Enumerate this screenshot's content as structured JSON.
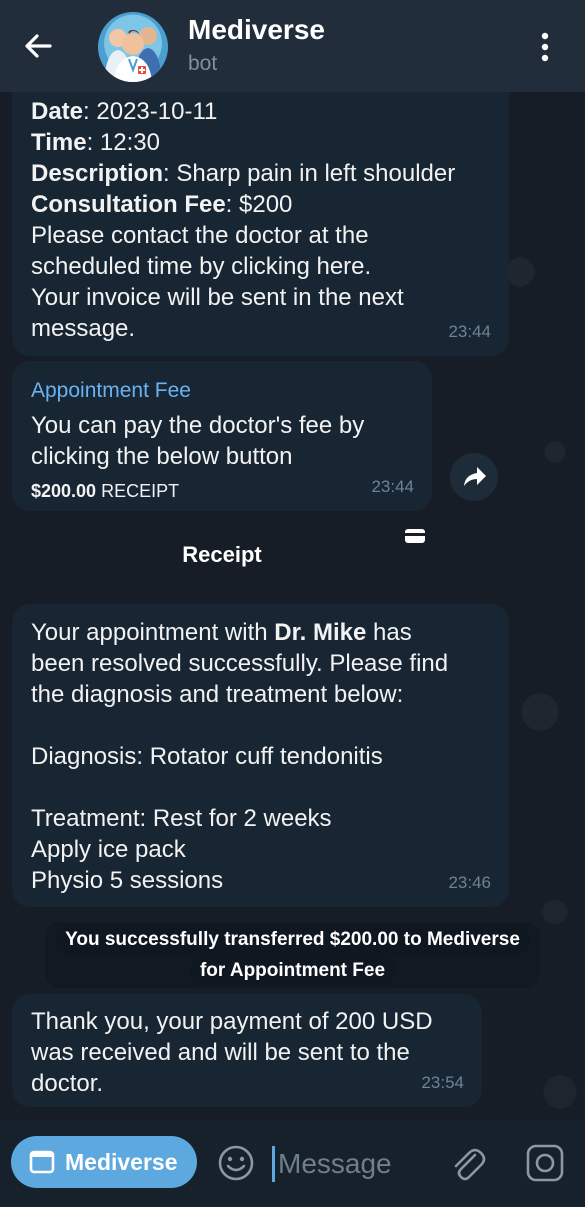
{
  "header": {
    "title": "Mediverse",
    "subtitle": "bot",
    "back_icon": "arrow-left-icon",
    "menu_icon": "more-vertical-icon"
  },
  "messages": {
    "first": {
      "date_label": "Date",
      "date_value": ": 2023-10-11",
      "time_label": "Time",
      "time_value": ": 12:30",
      "description_label": "Description",
      "description_value": ": Sharp pain in left shoulder",
      "fee_label": "Consultation Fee",
      "fee_value": ": $200",
      "lines": [
        "Please contact the doctor at the",
        "scheduled time by clicking here.",
        "Your invoice will be sent in the next",
        "message."
      ],
      "time": "23:44"
    },
    "invoice": {
      "title": "Appointment Fee",
      "lines": [
        "You can pay the doctor's fee by",
        "clicking the below button"
      ],
      "amount": "$200.00",
      "amount_suffix": " RECEIPT",
      "time": "23:44",
      "forward_icon": "share-forward-icon"
    },
    "receipt_button": {
      "label": "Receipt",
      "icon": "credit-card-icon"
    },
    "resolution": {
      "intro_before": "Your appointment with ",
      "doctor": "Dr. Mike",
      "intro_after": " has",
      "lines": [
        "been resolved successfully. Please find",
        "the diagnosis and treatment below:"
      ],
      "diagnosis": "Diagnosis: Rotator cuff tendonitis",
      "treatment_lines": [
        "Treatment: Rest for 2 weeks",
        "Apply ice pack",
        "Physio 5 sessions"
      ],
      "time": "23:46"
    },
    "service": {
      "line1": "You successfully transferred $200.00 to Mediverse",
      "line2": "for Appointment Fee"
    },
    "payment": {
      "lines": [
        "Thank you, your payment of 200 USD",
        "was received and will be sent to the",
        "doctor."
      ],
      "time": "23:54"
    }
  },
  "input_bar": {
    "menu_label": "Mediverse",
    "placeholder": "Message",
    "emoji_icon": "emoji-icon",
    "attach_icon": "paperclip-icon",
    "camera_icon": "camera-icon"
  },
  "colors": {
    "header_bg": "#212d3b",
    "bubble_bg": "#182533",
    "accent": "#5ea8e0",
    "link": "#6ab3f3"
  }
}
